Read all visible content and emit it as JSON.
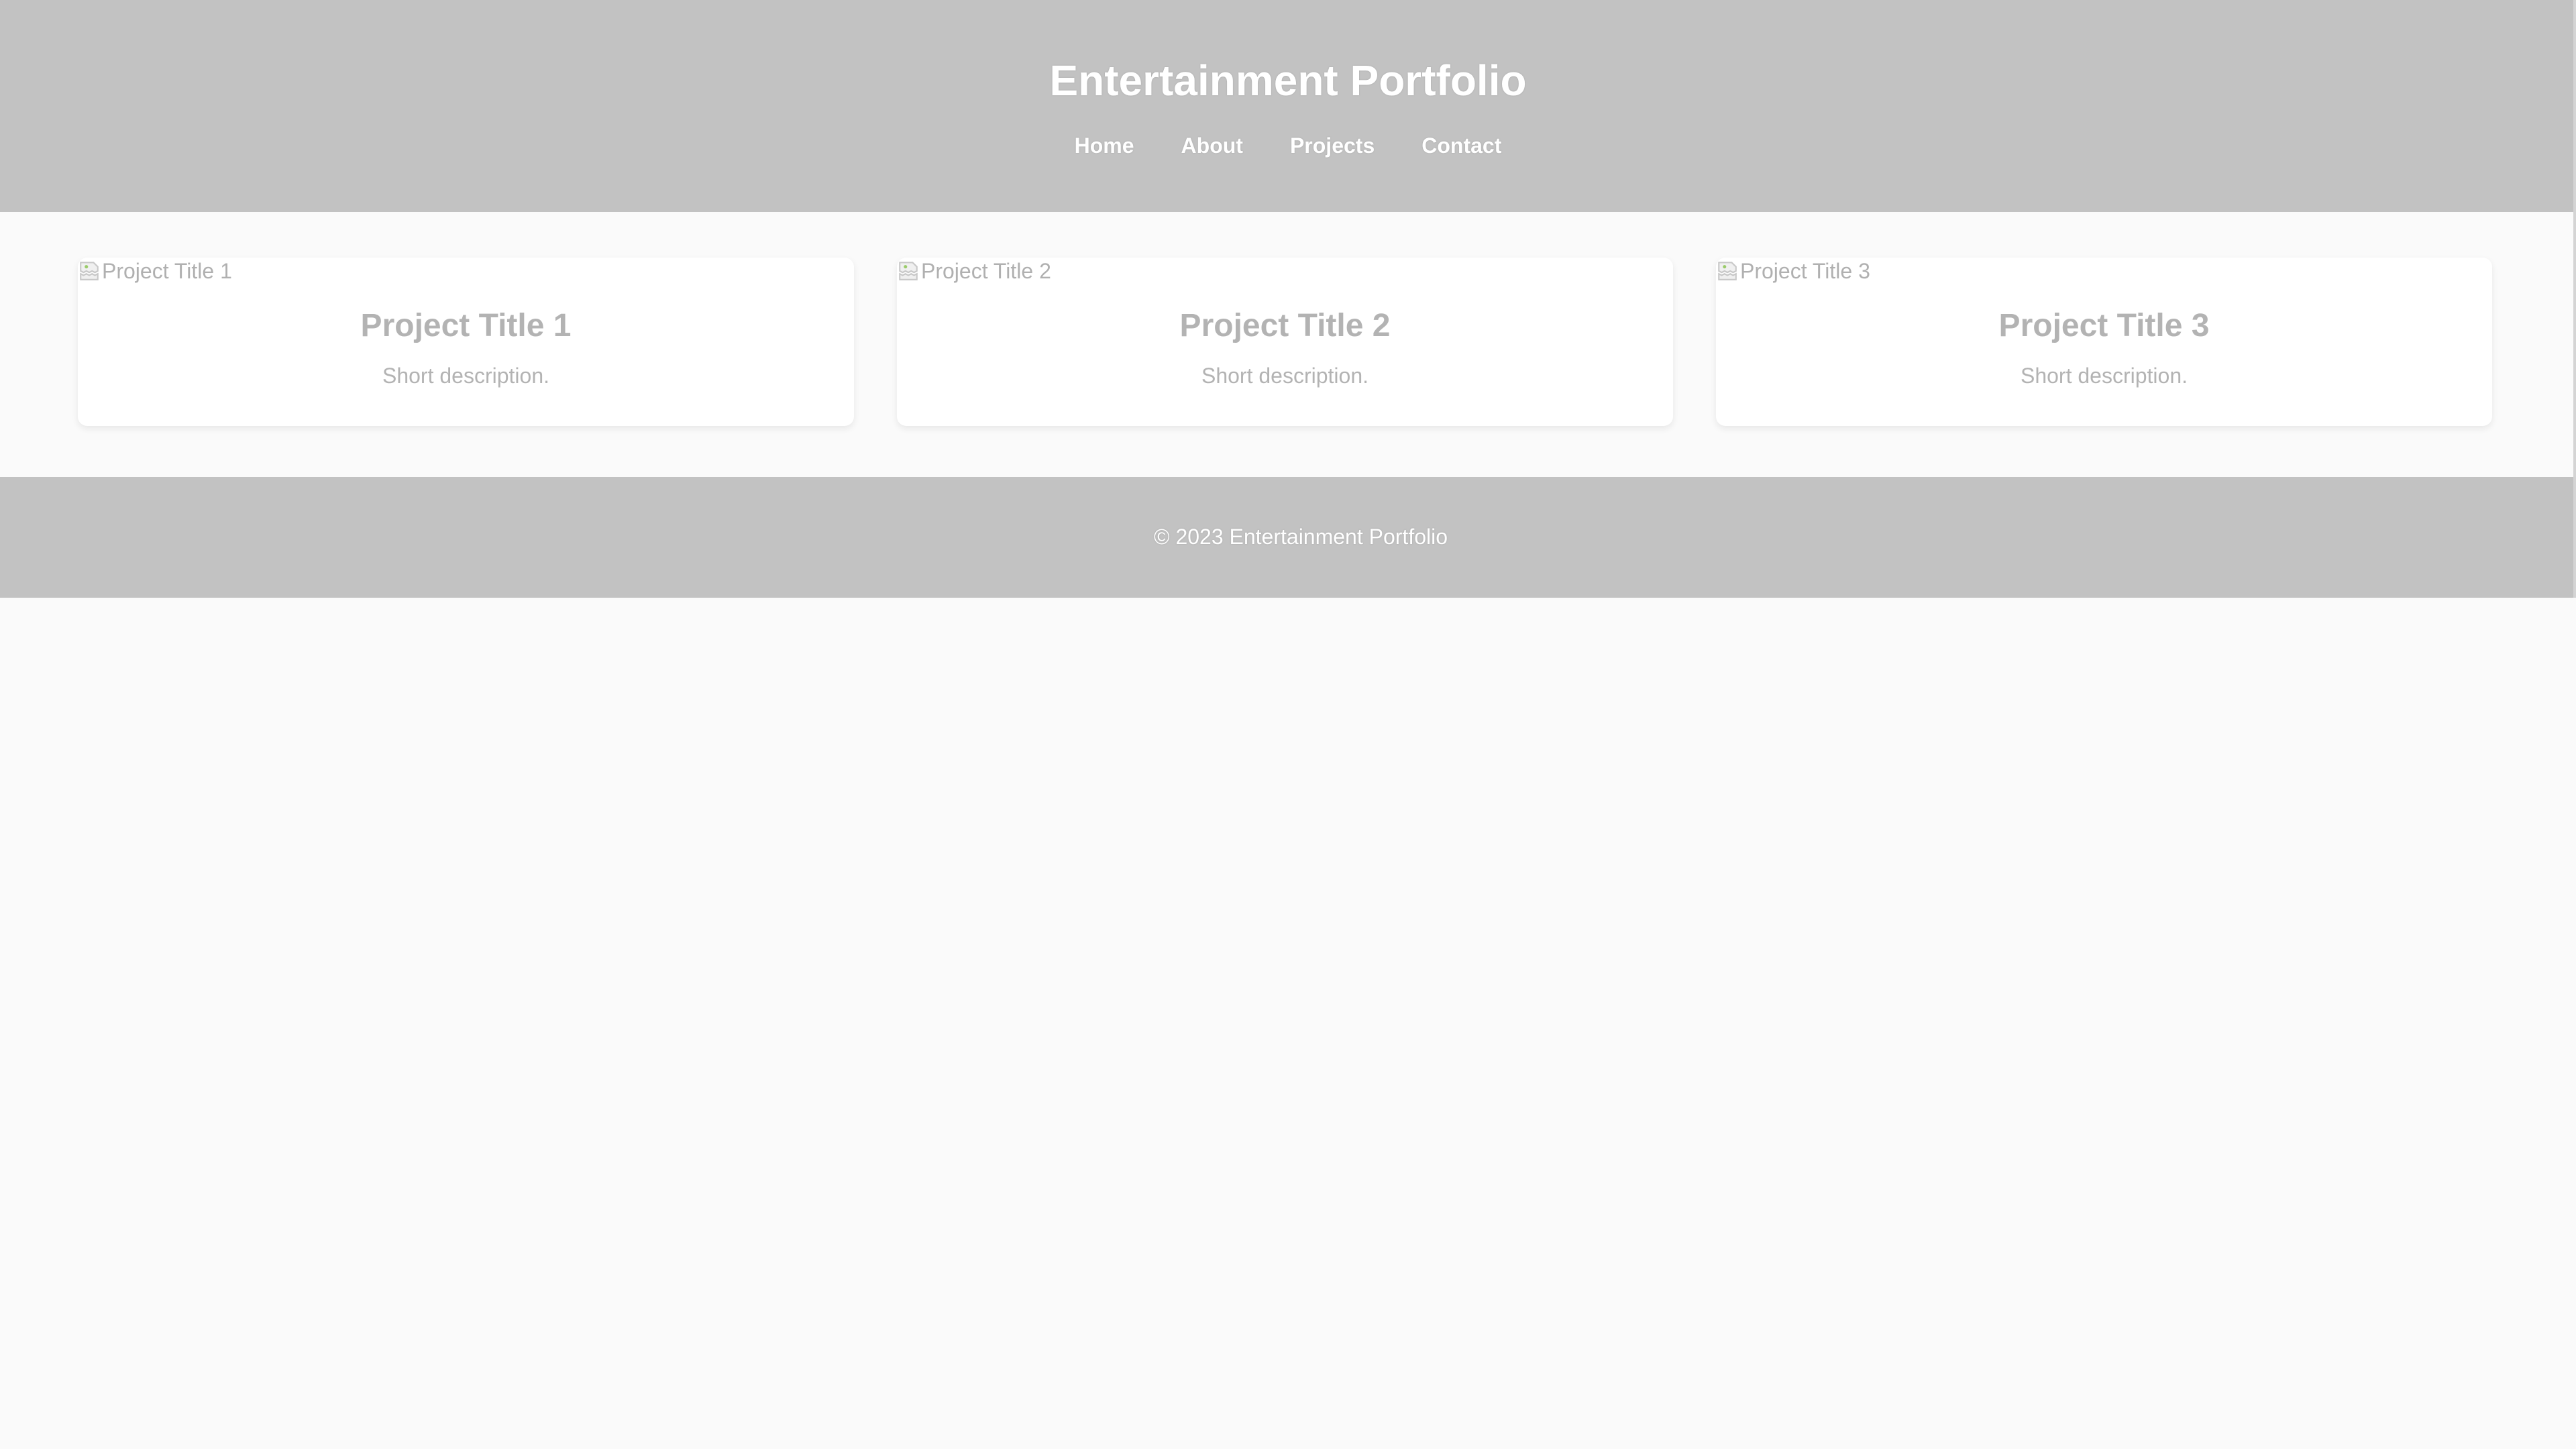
{
  "header": {
    "title": "Entertainment Portfolio",
    "nav": {
      "home": "Home",
      "about": "About",
      "projects": "Projects",
      "contact": "Contact"
    }
  },
  "projects": [
    {
      "image_alt": "Project Title 1",
      "title": "Project Title 1",
      "description": "Short description."
    },
    {
      "image_alt": "Project Title 2",
      "title": "Project Title 2",
      "description": "Short description."
    },
    {
      "image_alt": "Project Title 3",
      "title": "Project Title 3",
      "description": "Short description."
    }
  ],
  "footer": {
    "text": "© 2023 Entertainment Portfolio"
  },
  "colors": {
    "header_bg": "#c2c2c2",
    "page_bg": "#fafafa",
    "card_bg": "#ffffff",
    "muted_text": "#b3b3b3"
  },
  "icons": {
    "card_image": "broken-image-icon"
  }
}
